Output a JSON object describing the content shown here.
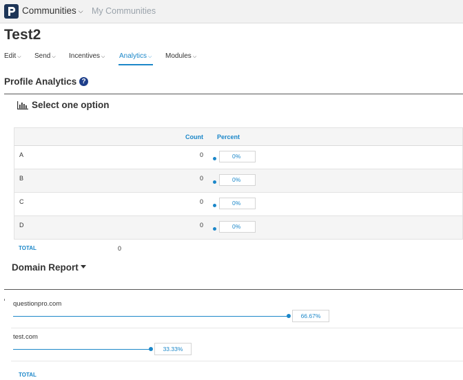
{
  "topbar": {
    "logo_letter": "P",
    "app_switcher_label": "Communities",
    "my_communities_label": "My Communities"
  },
  "page": {
    "title": "Test2"
  },
  "nav": {
    "items": [
      {
        "label": "Edit",
        "active": false
      },
      {
        "label": "Send",
        "active": false
      },
      {
        "label": "Incentives",
        "active": false
      },
      {
        "label": "Analytics",
        "active": true
      },
      {
        "label": "Modules",
        "active": false
      }
    ]
  },
  "analytics": {
    "section_title": "Profile Analytics",
    "help_icon": "question-circle-icon",
    "question": {
      "icon": "bar-chart-icon",
      "title": "Select one option",
      "columns": {
        "count": "Count",
        "percent": "Percent"
      },
      "rows": [
        {
          "label": "A",
          "count": "0",
          "percent": "0%"
        },
        {
          "label": "B",
          "count": "0",
          "percent": "0%"
        },
        {
          "label": "C",
          "count": "0",
          "percent": "0%"
        },
        {
          "label": "D",
          "count": "0",
          "percent": "0%"
        }
      ],
      "total_label": "TOTAL",
      "total_value": "0"
    }
  },
  "domain_report": {
    "title": "Domain Report",
    "domains": [
      {
        "name": "questionpro.com",
        "percent_label": "66.67%",
        "share": 0.6667
      },
      {
        "name": "test.com",
        "percent_label": "33.33%",
        "share": 0.3333
      }
    ],
    "total_label": "TOTAL"
  },
  "colors": {
    "accent": "#1b87c9",
    "brand": "#1d3557",
    "text": "#333333",
    "muted": "#9aa3ab"
  }
}
